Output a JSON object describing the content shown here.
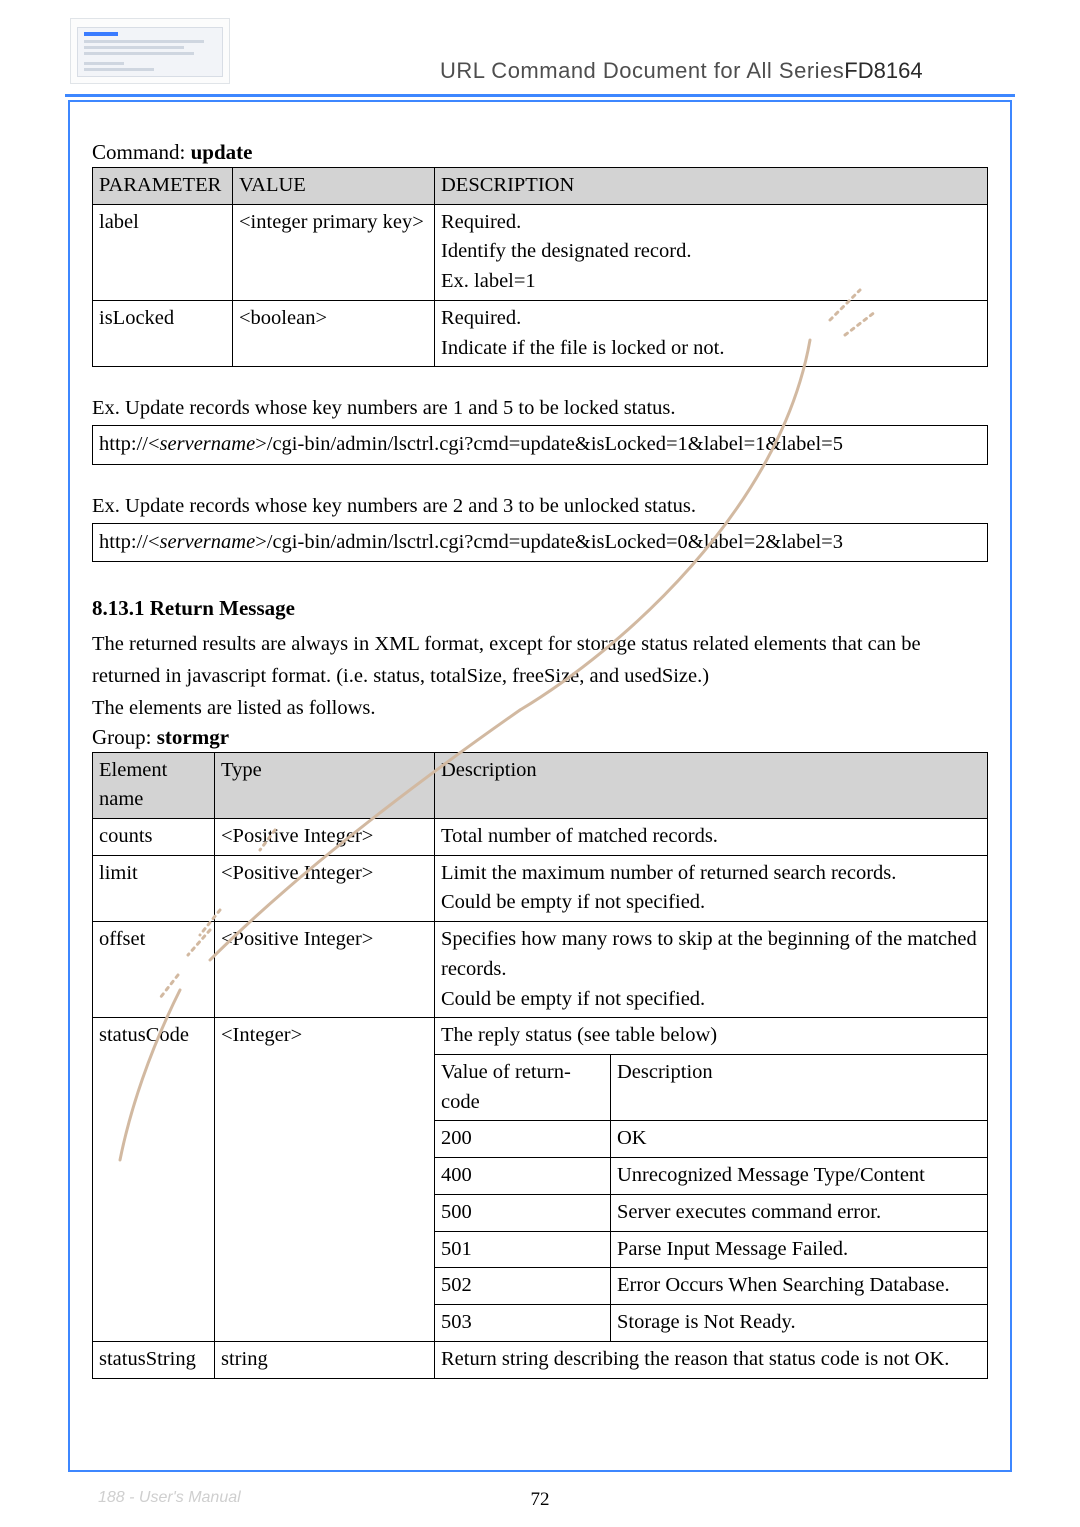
{
  "header": {
    "title_a": "URL Command Document for ",
    "title_b": "All Series",
    "title_c": "FD8164"
  },
  "command": {
    "label": "Command: ",
    "name": "update"
  },
  "paramTable": {
    "headers": [
      "PARAMETER",
      "VALUE",
      "DESCRIPTION"
    ],
    "rows": [
      {
        "param": "label",
        "value": "<integer primary key>",
        "desc": [
          "Required.",
          "Identify the designated record.",
          "Ex. label=1"
        ]
      },
      {
        "param": "isLocked",
        "value": "<boolean>",
        "desc": [
          "Required.",
          "Indicate if the file is locked or not."
        ]
      }
    ]
  },
  "ex1": {
    "text": "Ex. Update records whose key numbers are 1 and 5 to be locked status.",
    "url_pre": "http://<",
    "url_srv": "servername",
    "url_post": ">/cgi-bin/admin/lsctrl.cgi?cmd=update&isLocked=1&label=1&label=5"
  },
  "ex2": {
    "text": "Ex. Update records whose key numbers are 2 and 3 to be unlocked status.",
    "url_pre": "http://<",
    "url_srv": "servername",
    "url_post": ">/cgi-bin/admin/lsctrl.cgi?cmd=update&isLocked=0&label=2&label=3"
  },
  "section": {
    "heading": "8.13.1 Return Message",
    "para1": "The returned results are always in XML format, except for storage status related elements that can be returned in javascript format. (i.e. status, totalSize, freeSize, and usedSize.)",
    "para2": "The elements are listed as follows."
  },
  "group": {
    "label": "Group: ",
    "name": "stormgr"
  },
  "elemTable": {
    "headers": [
      "Element name",
      "Type",
      "Description"
    ],
    "rows": {
      "counts": {
        "name": "counts",
        "type": "<Positive Integer>",
        "desc": "Total number of matched records."
      },
      "limit": {
        "name": "limit",
        "type": "<Positive Integer>",
        "desc": [
          "Limit the maximum number of returned search records.",
          "Could be empty if not specified."
        ]
      },
      "offset": {
        "name": "offset",
        "type": "<Positive Integer>",
        "desc": [
          "Specifies how many rows to skip at the beginning of the matched records.",
          "Could be empty if not specified."
        ]
      },
      "statusCode": {
        "name": "statusCode",
        "type": "<Integer>",
        "desc": "The reply status (see table below)",
        "subHeaders": [
          "Value of return-code",
          "Description"
        ],
        "sub": [
          [
            "200",
            "OK"
          ],
          [
            "400",
            "Unrecognized Message Type/Content"
          ],
          [
            "500",
            "Server executes command error."
          ],
          [
            "501",
            "Parse Input Message Failed."
          ],
          [
            "502",
            "Error Occurs When Searching Database."
          ],
          [
            "503",
            "Storage is Not Ready."
          ]
        ]
      },
      "statusString": {
        "name": "statusString",
        "type": "string",
        "desc": "Return string describing the reason that status code is not OK."
      }
    }
  },
  "footer": {
    "left": "188 - User's Manual",
    "center": "72"
  },
  "chart_data": {
    "type": "table",
    "note": "document page; primary data represented in paramTable and elemTable above"
  }
}
